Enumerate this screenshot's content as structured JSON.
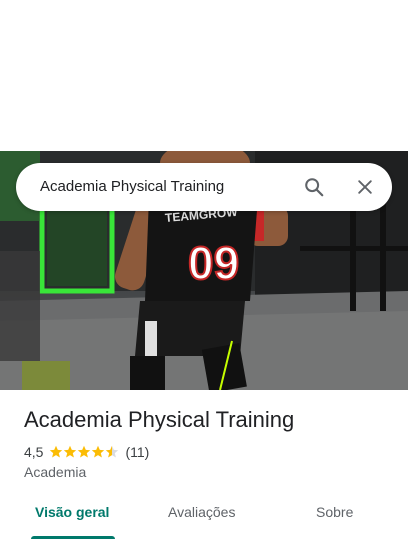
{
  "search": {
    "query": "Academia Physical Training"
  },
  "place": {
    "name": "Academia Physical Training",
    "rating": "4,5",
    "rating_value": 4.5,
    "review_count": "(11)",
    "category": "Academia"
  },
  "hero": {
    "jersey_text": "TEAMGROW",
    "jersey_number": "09"
  },
  "tabs": [
    {
      "label": "Visão geral",
      "active": true
    },
    {
      "label": "Avaliações",
      "active": false
    },
    {
      "label": "Sobre",
      "active": false
    }
  ],
  "colors": {
    "accent": "#00796b",
    "star": "#fbbc04",
    "star_empty": "#dadce0"
  },
  "icons": {
    "search": "search-icon",
    "close": "close-icon",
    "star": "star-icon"
  }
}
